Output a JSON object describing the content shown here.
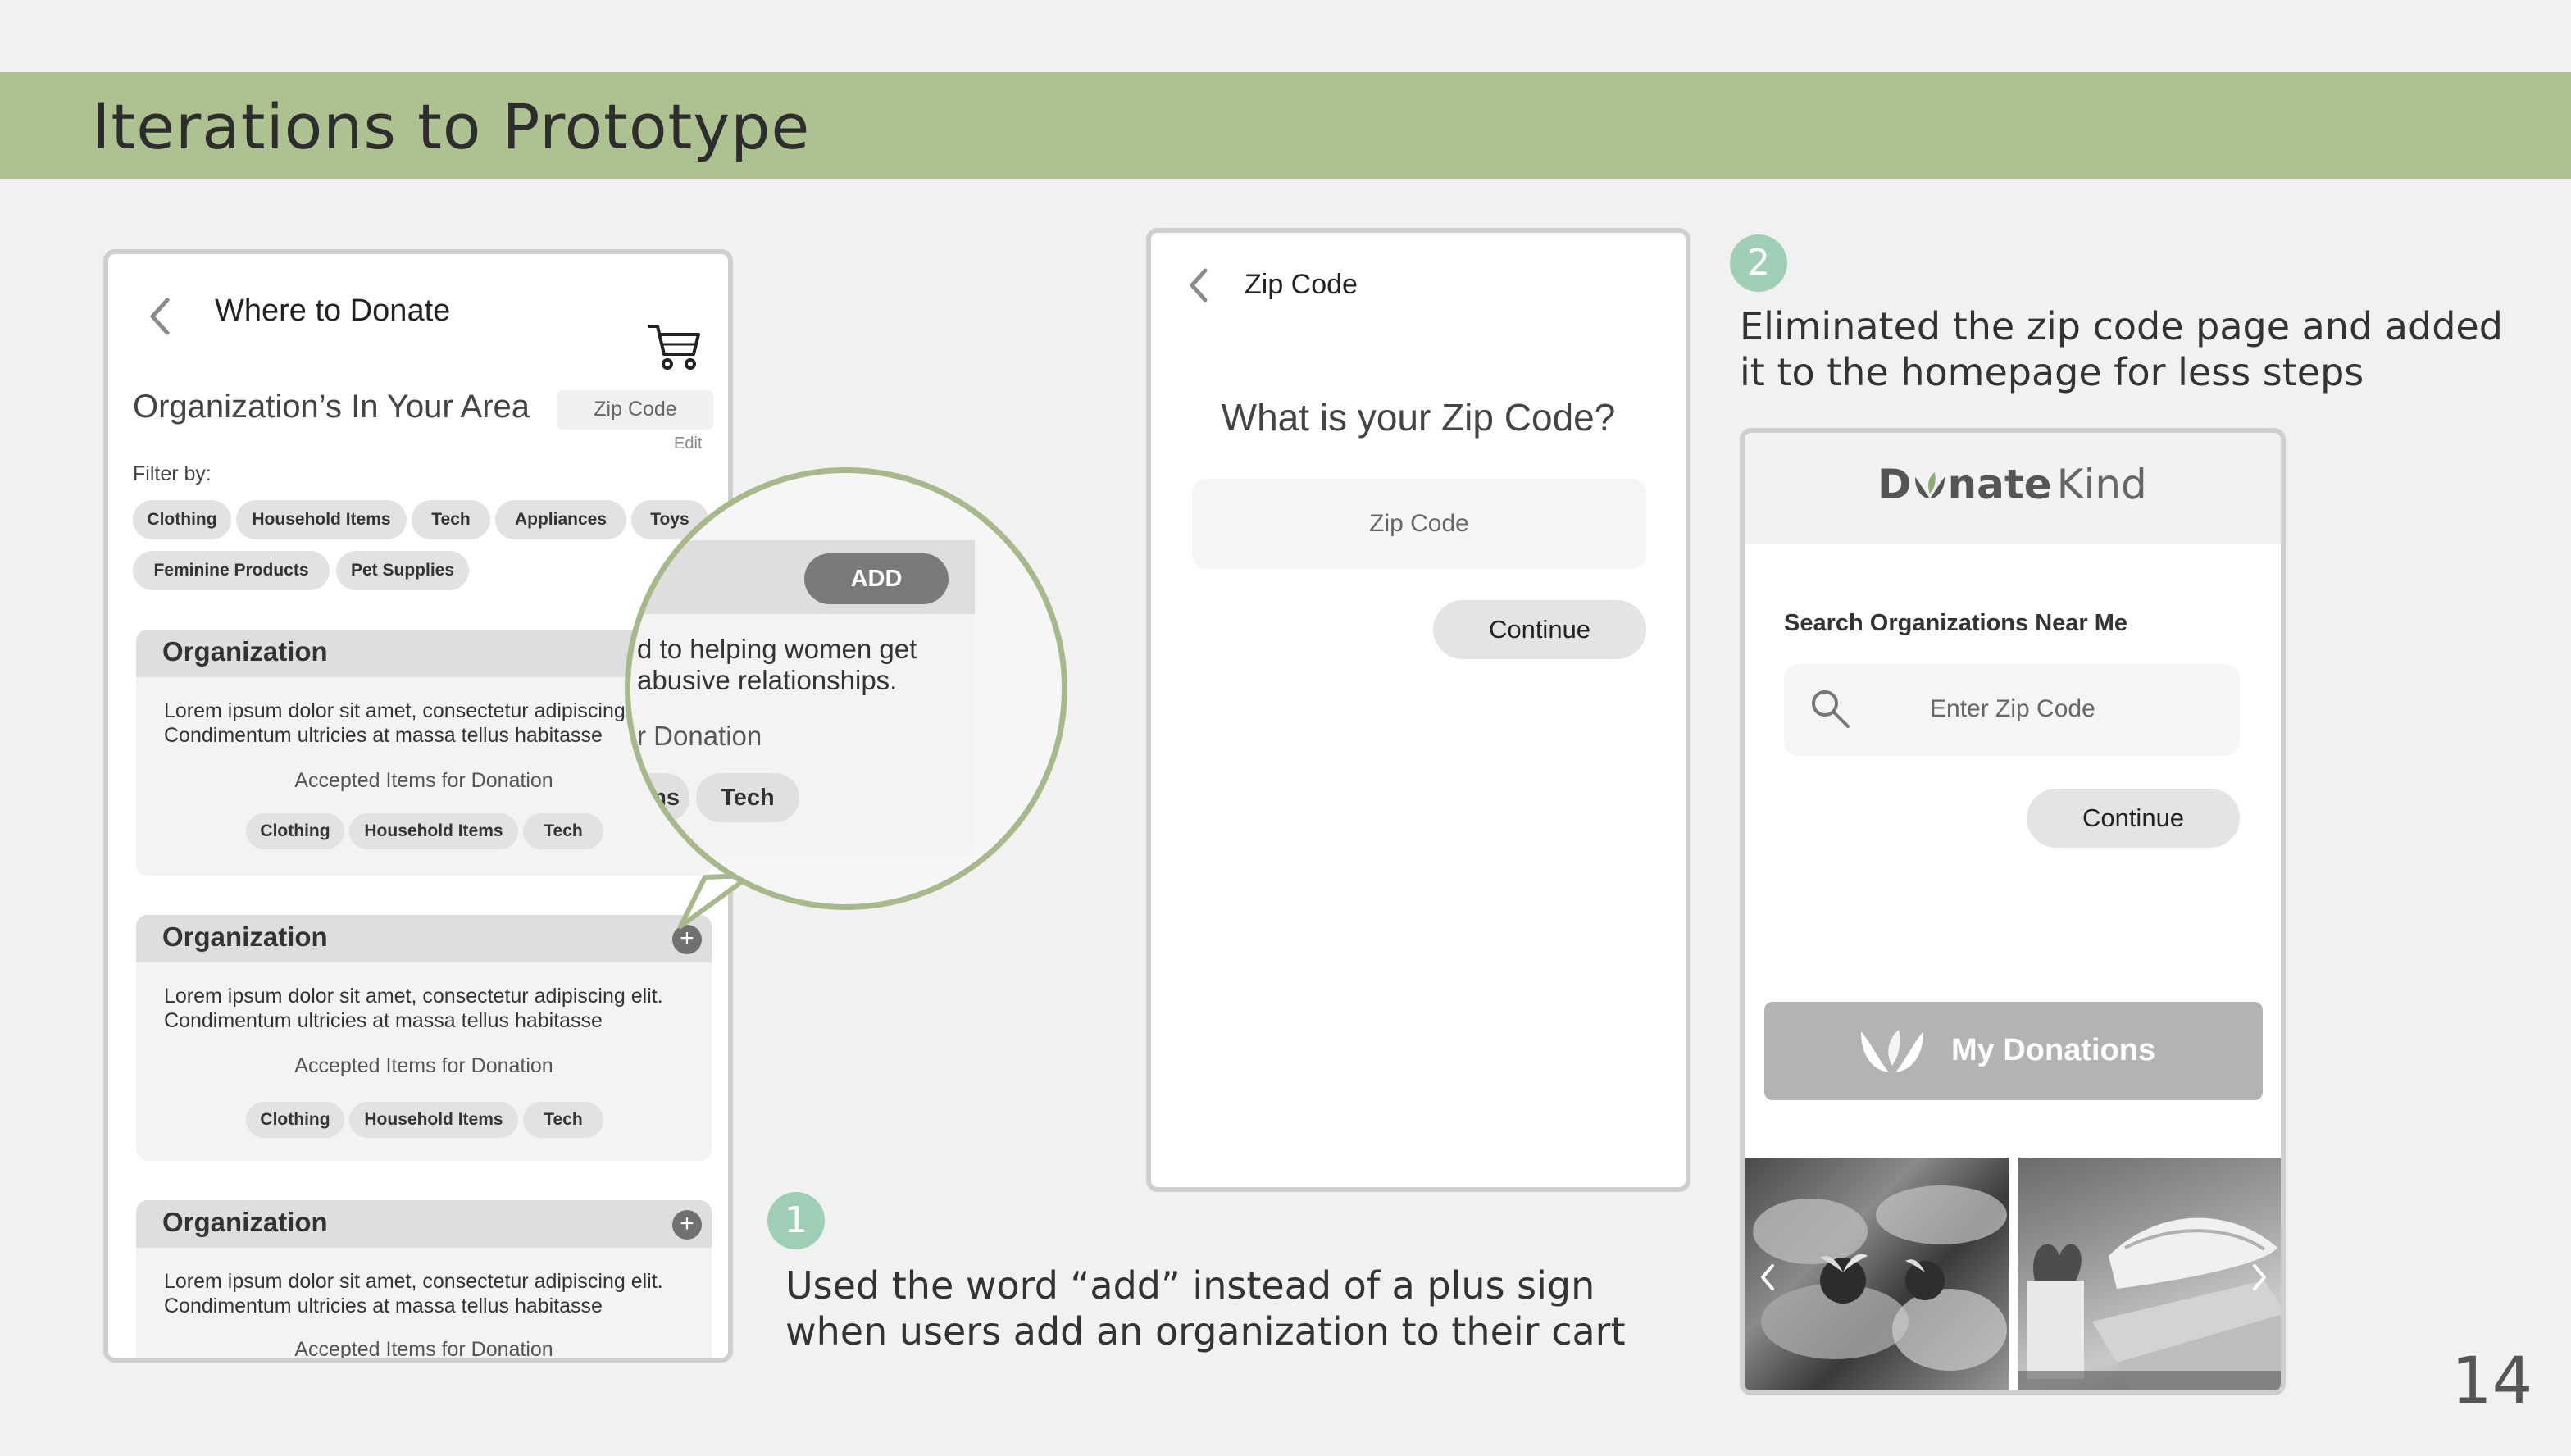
{
  "slide": {
    "title": "Iterations to Prototype",
    "page_number": "14",
    "accent_color": "#aec191",
    "badge_color": "#9ecfb4"
  },
  "screen1": {
    "header_title": "Where to Donate",
    "section_title": "Organization’s In Your Area",
    "zip_placeholder": "Zip Code",
    "edit_label": "Edit",
    "filter_label": "Filter by:",
    "filters": [
      "Clothing",
      "Household Items",
      "Tech",
      "Appliances",
      "Toys",
      "Feminine Products",
      "Pet Supplies"
    ],
    "cards": [
      {
        "title": "Organization",
        "description": "Lorem ipsum dolor sit amet, consectetur adipiscing elit. Condimentum ultricies at massa tellus habitasse",
        "accepted_label": "Accepted Items for Donation",
        "chips": [
          "Clothing",
          "Household Items",
          "Tech"
        ]
      },
      {
        "title": "Organization",
        "description": "Lorem ipsum dolor sit amet, consectetur adipiscing elit. Condimentum ultricies at massa tellus habitasse",
        "accepted_label": "Accepted Items for Donation",
        "chips": [
          "Clothing",
          "Household Items",
          "Tech"
        ]
      },
      {
        "title": "Organization",
        "description": "Lorem ipsum dolor sit amet, consectetur adipiscing elit. Condimentum ultricies at massa tellus habitasse",
        "accepted_label": "Accepted Items for Donation",
        "chips": []
      }
    ],
    "plus_symbol": "+"
  },
  "zoom": {
    "add_label": "ADD",
    "text_line1": "d to helping women get",
    "text_line2": "abusive relationships.",
    "donation_text": "r Donation",
    "chip_partial": "ems",
    "chip_tech": "Tech"
  },
  "screen2": {
    "header_title": "Zip Code",
    "question": "What is your Zip Code?",
    "zip_placeholder": "Zip Code",
    "continue_label": "Continue"
  },
  "screen3": {
    "logo_d": "D",
    "logo_nate": "nate",
    "logo_kind": "Kind",
    "search_label": "Search Organizations Near Me",
    "zip_placeholder": "Enter Zip Code",
    "continue_label": "Continue",
    "my_donations_label": "My Donations"
  },
  "annotations": [
    {
      "number": "1",
      "text_line1": "Used the word “add” instead of a plus sign",
      "text_line2": "when users add an organization to their cart"
    },
    {
      "number": "2",
      "text_line1": "Eliminated the zip code page and added",
      "text_line2": "it to the homepage for less steps"
    }
  ]
}
